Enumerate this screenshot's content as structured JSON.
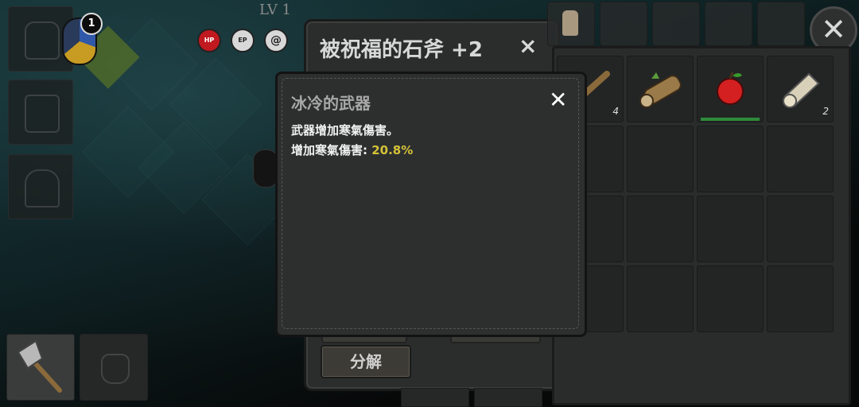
{
  "hud": {
    "level_text": "LV 1",
    "compass_badge": "1",
    "stats": [
      {
        "name": "hp",
        "label": "HP",
        "color": "#c0191f"
      },
      {
        "name": "ep",
        "label": "EP",
        "color": "#d8d8d8"
      },
      {
        "name": "swirl",
        "label": "@",
        "color": "#d8d8d8"
      }
    ]
  },
  "item_panel": {
    "title": "被祝福的石斧 +2",
    "close_symbol": "×",
    "disassemble_label": "分解"
  },
  "inventory": {
    "close_symbol": "✕",
    "items": [
      {
        "slot": 0,
        "icon": "wood-stick-icon",
        "count": "4"
      },
      {
        "slot": 1,
        "icon": "log-icon",
        "count": ""
      },
      {
        "slot": 2,
        "icon": "apple-icon",
        "count": ""
      },
      {
        "slot": 3,
        "icon": "cloth-roll-icon",
        "count": "2"
      }
    ]
  },
  "modal": {
    "title": "冰冷的武器",
    "close_symbol": "✕",
    "description": "武器增加寒氣傷害。",
    "stat_label": "增加寒氣傷害: ",
    "stat_value": "20.8%",
    "stat_value_color": "#d4c238"
  },
  "equipment": {
    "weapon_icon": "stone-axe-icon",
    "glove_icon": "glove-icon"
  }
}
